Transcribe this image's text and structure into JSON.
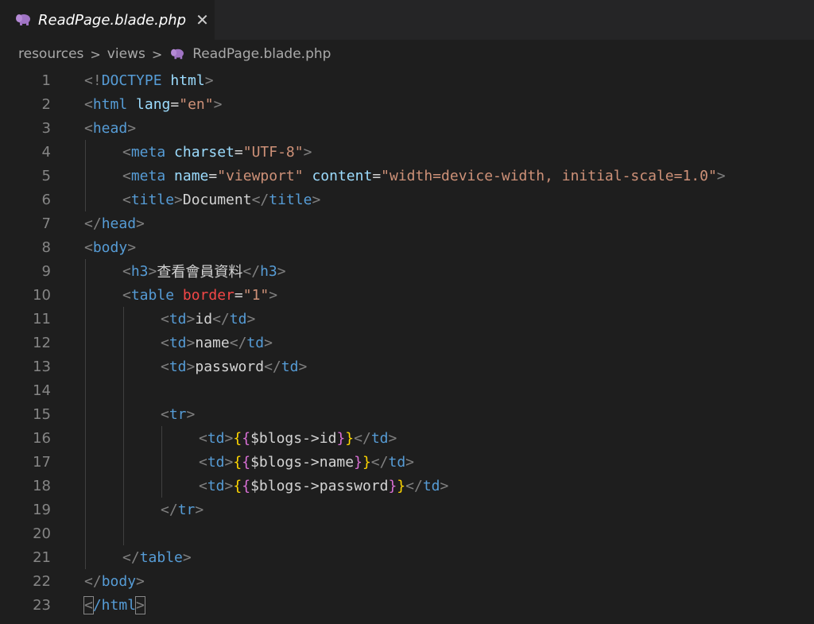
{
  "tab": {
    "label": "ReadPage.blade.php",
    "icon": "php-elephant-icon",
    "close": "✕",
    "accent": "#a074c4"
  },
  "breadcrumb": {
    "items": [
      "resources",
      "views",
      "ReadPage.blade.php"
    ],
    "separator": ">"
  },
  "code": {
    "line_numbers": [
      "1",
      "2",
      "3",
      "4",
      "5",
      "6",
      "7",
      "8",
      "9",
      "10",
      "11",
      "12",
      "13",
      "14",
      "15",
      "16",
      "17",
      "18",
      "19",
      "20",
      "21",
      "22",
      "23"
    ],
    "l1": {
      "a": "<!",
      "b": "DOCTYPE",
      "c": " html",
      "d": ">"
    },
    "l2": {
      "a": "<",
      "b": "html",
      "c": " lang",
      "d": "=",
      "e": "\"en\"",
      "f": ">"
    },
    "l3": {
      "a": "<",
      "b": "head",
      "c": ">"
    },
    "l4": {
      "a": "<",
      "b": "meta",
      "c": " charset",
      "d": "=",
      "e": "\"UTF-8\"",
      "f": ">"
    },
    "l5": {
      "a": "<",
      "b": "meta",
      "c": " name",
      "d": "=",
      "e": "\"viewport\"",
      "f": " content",
      "g": "=",
      "h": "\"width=device-width, initial-scale=1.0\"",
      "i": ">"
    },
    "l6": {
      "a": "<",
      "b": "title",
      "c": ">",
      "d": "Document",
      "e": "</",
      "f": "title",
      "g": ">"
    },
    "l7": {
      "a": "</",
      "b": "head",
      "c": ">"
    },
    "l8": {
      "a": "<",
      "b": "body",
      "c": ">"
    },
    "l9": {
      "a": "<",
      "b": "h3",
      "c": ">",
      "d": "查看會員資料",
      "e": "</",
      "f": "h3",
      "g": ">"
    },
    "l10": {
      "a": "<",
      "b": "table",
      "c": " border",
      "d": "=",
      "e": "\"1\"",
      "f": ">"
    },
    "l11": {
      "a": "<",
      "b": "td",
      "c": ">",
      "d": "id",
      "e": "</",
      "f": "td",
      "g": ">"
    },
    "l12": {
      "a": "<",
      "b": "td",
      "c": ">",
      "d": "name",
      "e": "</",
      "f": "td",
      "g": ">"
    },
    "l13": {
      "a": "<",
      "b": "td",
      "c": ">",
      "d": "password",
      "e": "</",
      "f": "td",
      "g": ">"
    },
    "l15": {
      "a": "<",
      "b": "tr",
      "c": ">"
    },
    "l16": {
      "a": "<",
      "b": "td",
      "c": ">",
      "d": "{",
      "e": "{",
      "f": "$blogs->id",
      "g": "}",
      "h": "}",
      "i": "</",
      "j": "td",
      "k": ">"
    },
    "l17": {
      "a": "<",
      "b": "td",
      "c": ">",
      "d": "{",
      "e": "{",
      "f": "$blogs->name",
      "g": "}",
      "h": "}",
      "i": "</",
      "j": "td",
      "k": ">"
    },
    "l18": {
      "a": "<",
      "b": "td",
      "c": ">",
      "d": "{",
      "e": "{",
      "f": "$blogs->password",
      "g": "}",
      "h": "}",
      "i": "</",
      "j": "td",
      "k": ">"
    },
    "l19": {
      "a": "</",
      "b": "tr",
      "c": ">"
    },
    "l21": {
      "a": "</",
      "b": "table",
      "c": ">"
    },
    "l22": {
      "a": "</",
      "b": "body",
      "c": ">"
    },
    "l23": {
      "a": "<",
      "b": "/html",
      "c": ">"
    }
  }
}
